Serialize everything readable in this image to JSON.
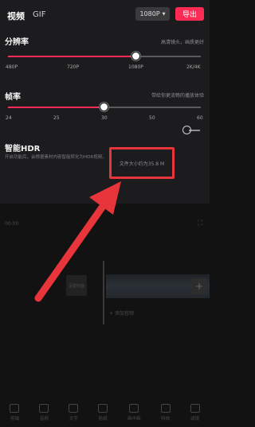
{
  "header": {
    "tabs": [
      "视频",
      "GIF"
    ],
    "resolution_selected": "1080P",
    "export_label": "导出"
  },
  "resolution": {
    "title": "分辨率",
    "hint": "高清镜头，画质更好",
    "ticks": [
      "480P",
      "720P",
      "1080P",
      "2K/4K"
    ],
    "value": "1080P"
  },
  "framerate": {
    "title": "帧率",
    "hint": "带给你更流畅的播放体验",
    "ticks": [
      "24",
      "25",
      "30",
      "50",
      "60"
    ],
    "value": "30"
  },
  "hdr": {
    "title": "智能HDR",
    "description": "开启功能后，会根据素材内容智能转化为HDR视频。",
    "enabled": false
  },
  "file_size_text": "文件大小约为35.8 M",
  "editor": {
    "time": "00:00",
    "clip_label": "设置封面",
    "add_audio": "+ 添加音频"
  },
  "toolbar": [
    "剪辑",
    "音频",
    "文字",
    "贴纸",
    "画中画",
    "特效",
    "滤镜"
  ],
  "colors": {
    "accent": "#fe2c55",
    "highlight_box": "#e8353c",
    "arrow": "#e8353c"
  }
}
